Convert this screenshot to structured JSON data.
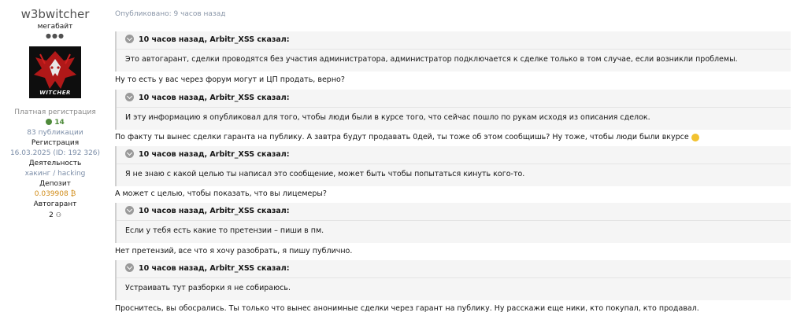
{
  "author": {
    "username": "w3bwitcher",
    "rank": "мегабайт",
    "dots": "●●●",
    "avatar_caption": "WITCHER",
    "registration_type": "Платная регистрация",
    "reputation": "14",
    "publications": "83 публикации",
    "registration_label": "Регистрация",
    "registration_value": "16.03.2025 (ID: 192 326)",
    "activity_label": "Деятельность",
    "activity_value": "хакинг / hacking",
    "deposit_label": "Депозит",
    "deposit_value": "0.039908",
    "deposit_currency": "₿",
    "guarantor_label": "Автогарант",
    "guarantor_value": "2"
  },
  "post": {
    "published": "Опубликовано: 9 часов назад",
    "items": [
      {
        "quote_head": "10 часов назад, Arbitr_XSS сказал:",
        "quote_body": "Это автогарант, сделки проводятся без участия администратора, администратор подключается к сделке только в том случае, если возникли проблемы."
      },
      {
        "text": "Ну то есть у вас через форум могут и ЦП продать, верно?"
      },
      {
        "quote_head": "10 часов назад, Arbitr_XSS сказал:",
        "quote_body": "И эту информацию я опубликовал для того, чтобы люди были в курсе того, что сейчас пошло по рукам исходя из описания сделок."
      },
      {
        "text": "По факту ты вынес сделки гаранта на публику. А завтра будут продавать 0дей, ты тоже об этом сообщишь? Ну тоже, чтобы люди были вкурсе"
      },
      {
        "quote_head": "10 часов назад, Arbitr_XSS сказал:",
        "quote_body": "Я не знаю с какой целью ты написал это сообщение, может быть чтобы попытаться кинуть кого-то."
      },
      {
        "text": "А может с целью, чтобы показать, что вы лицемеры?"
      },
      {
        "quote_head": "10 часов назад, Arbitr_XSS сказал:",
        "quote_body": "Если у тебя есть какие то претензии – пиши в пм."
      },
      {
        "text": "Нет претензий, все что я хочу разобрать, я пишу публично."
      },
      {
        "quote_head": "10 часов назад, Arbitr_XSS сказал:",
        "quote_body": "Устраивать тут разборки я не собираюсь."
      },
      {
        "text": "Проснитесь, вы обосрались. Ты только что вынес анонимные сделки через гарант на публику. Ну расскажи еще ники, кто покупал, кто продавал."
      }
    ]
  }
}
